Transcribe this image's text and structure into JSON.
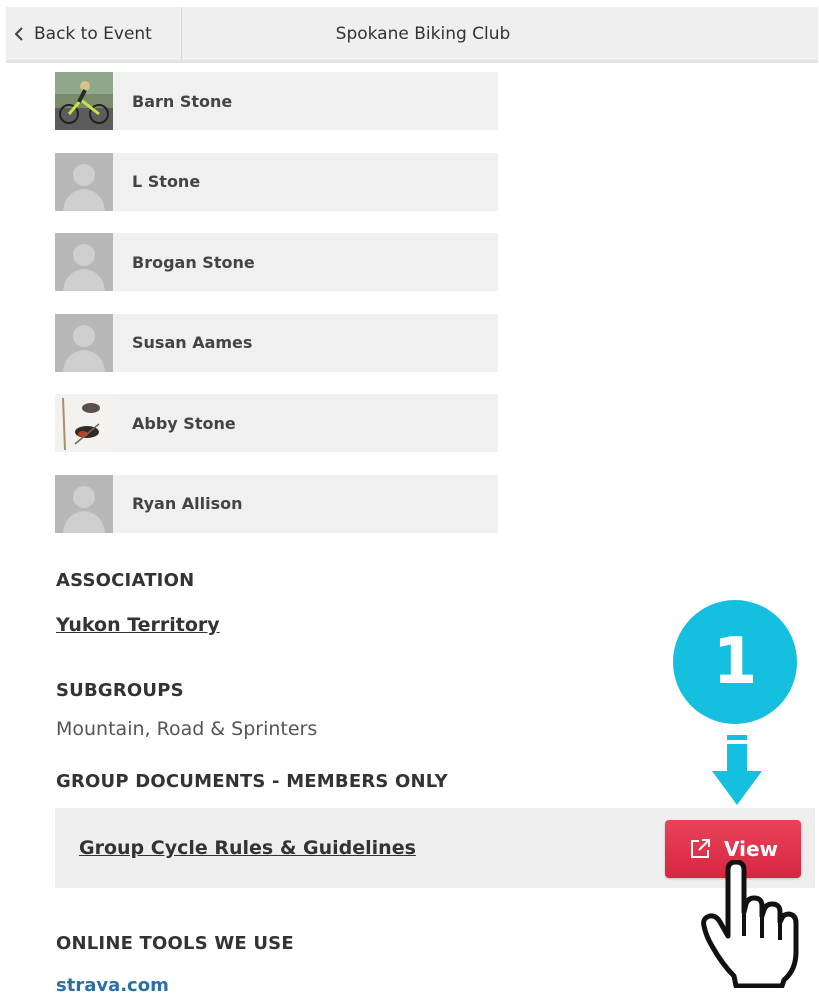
{
  "header": {
    "back_label": "Back to Event",
    "title": "Spokane Biking Club"
  },
  "members": [
    {
      "name": "Barn Stone",
      "avatar": "photo-cyclist"
    },
    {
      "name": "L Stone",
      "avatar": "placeholder"
    },
    {
      "name": "Brogan Stone",
      "avatar": "placeholder"
    },
    {
      "name": "Susan Aames",
      "avatar": "placeholder"
    },
    {
      "name": "Abby Stone",
      "avatar": "photo-birds"
    },
    {
      "name": "Ryan Allison",
      "avatar": "placeholder"
    }
  ],
  "association": {
    "heading": "ASSOCIATION",
    "link": "Yukon Territory"
  },
  "subgroups": {
    "heading": "SUBGROUPS",
    "value": "Mountain, Road & Sprinters"
  },
  "documents": {
    "heading": "GROUP DOCUMENTS - MEMBERS ONLY",
    "items": [
      {
        "title": "Group Cycle Rules & Guidelines",
        "action_label": "View"
      }
    ]
  },
  "tools": {
    "heading": "ONLINE TOOLS WE USE",
    "links": [
      "strava.com"
    ]
  },
  "annotation": {
    "step_number": "1"
  },
  "colors": {
    "view_button": "#d7263f",
    "step_badge": "#15bfe0",
    "link_blue": "#2a6fa8",
    "row_bg": "#f0f0f0"
  }
}
